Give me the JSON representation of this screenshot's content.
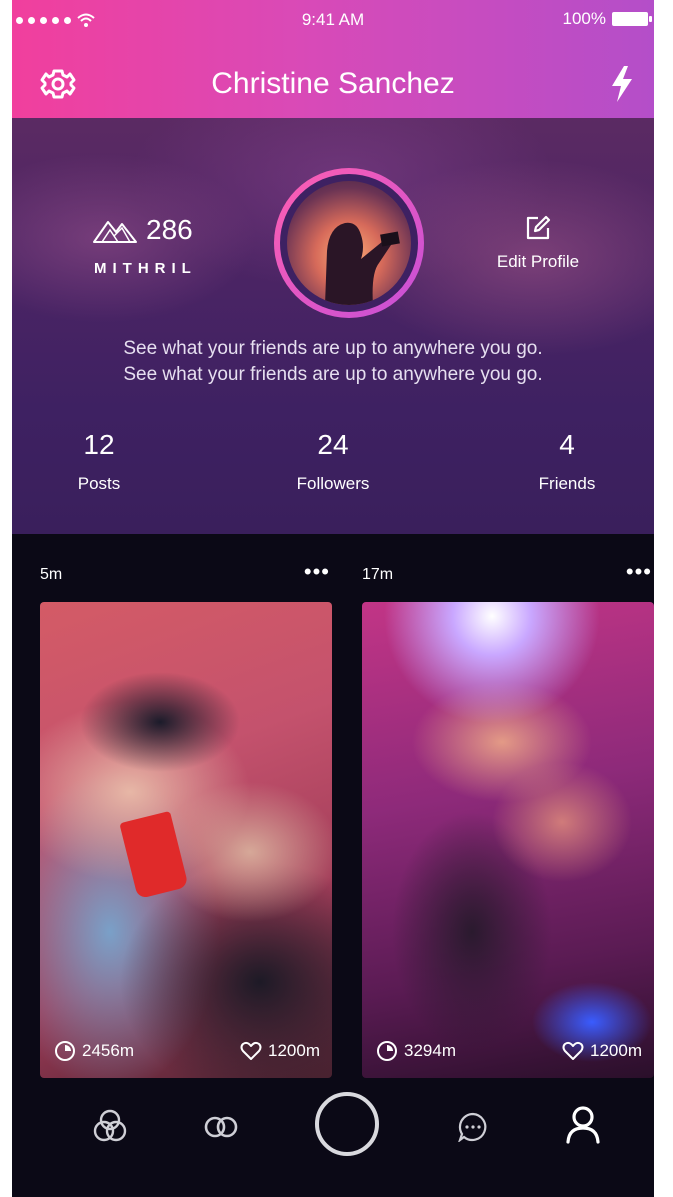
{
  "status_bar": {
    "time": "9:41 AM",
    "battery": "100%"
  },
  "nav": {
    "title": "Christine Sanchez"
  },
  "profile": {
    "brand_count": "286",
    "brand_name": "MITHRIL",
    "edit_label": "Edit Profile",
    "bio": [
      "See what your friends are up to anywhere you go.",
      "See what your friends are up to anywhere you go."
    ],
    "stats": [
      {
        "value": "12",
        "label": "Posts"
      },
      {
        "value": "24",
        "label": "Followers"
      },
      {
        "value": "4",
        "label": "Friends"
      }
    ]
  },
  "feed": [
    {
      "time": "5m",
      "distance": "2456m",
      "likes": "1200m"
    },
    {
      "time": "17m",
      "distance": "3294m",
      "likes": "1200m"
    }
  ],
  "tabs": [
    "explore-icon",
    "connect-icon",
    "camera-button",
    "messages-icon",
    "profile-icon"
  ],
  "colors": {
    "header_start": "#f13f9d",
    "header_end": "#b44ec9",
    "background": "#0b0916"
  }
}
